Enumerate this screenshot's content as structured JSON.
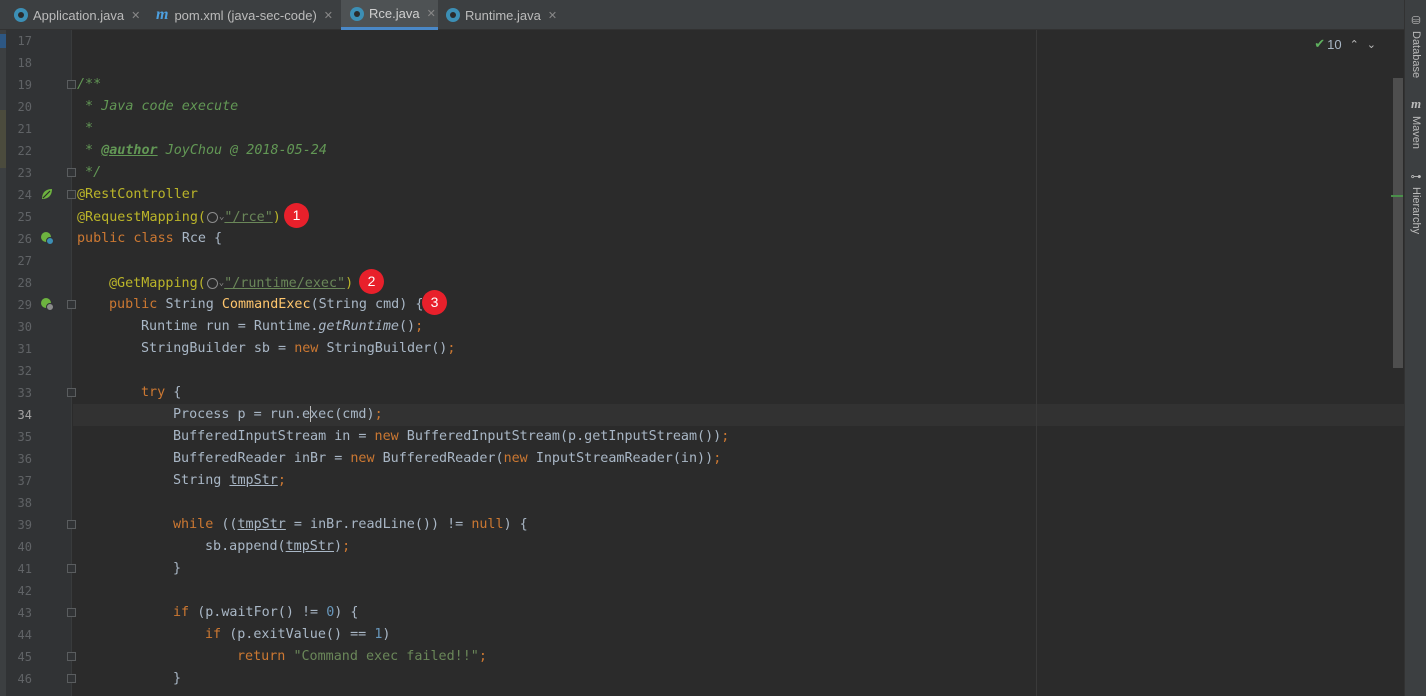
{
  "tabs": [
    {
      "label": "Application.java",
      "icon": "java-class-icon",
      "active": false
    },
    {
      "label": "pom.xml (java-sec-code)",
      "icon": "maven-icon",
      "active": false
    },
    {
      "label": "Rce.java",
      "icon": "java-class-icon",
      "active": true
    },
    {
      "label": "Runtime.java",
      "icon": "java-class-icon",
      "active": false
    }
  ],
  "tab_close_glyph": "✕",
  "line_numbers": [
    "17",
    "18",
    "19",
    "20",
    "21",
    "22",
    "23",
    "24",
    "25",
    "26",
    "27",
    "28",
    "29",
    "30",
    "31",
    "32",
    "33",
    "34",
    "35",
    "36",
    "37",
    "38",
    "39",
    "40",
    "41",
    "42",
    "43",
    "44",
    "45",
    "46"
  ],
  "current_line": "34",
  "code": {
    "l19": "/**",
    "l20": " * Java code execute",
    "l21": " *",
    "l22_pre": " * ",
    "l22_tag": "@author",
    "l22_post": " JoyChou @ 2018-05-24",
    "l23": " */",
    "l24": "@RestController",
    "l25_ann": "@RequestMapping(",
    "l25_str": "\"/rce\"",
    "l25_end": ")",
    "l26_kw": "public class ",
    "l26_rest": "Rce {",
    "l28_ann": "@GetMapping(",
    "l28_str": "\"/runtime/exec\"",
    "l28_end": ")",
    "l29_kw": "public ",
    "l29_type": "String ",
    "l29_fn": "CommandExec",
    "l29_rest": "(String cmd) {",
    "l30_a": "Runtime run = Runtime.",
    "l30_b": "getRuntime",
    "l30_c": "()",
    "l30_d": ";",
    "l31_a": "StringBuilder sb = ",
    "l31_b": "new ",
    "l31_c": "StringBuilder()",
    "l31_d": ";",
    "l33_a": "try ",
    "l33_b": "{",
    "l34_a": "Process p = run.e",
    "l34_b": "xec(cmd)",
    "l34_c": ";",
    "l35_a": "BufferedInputStream in = ",
    "l35_b": "new ",
    "l35_c": "BufferedInputStream(p.getInputStream())",
    "l35_d": ";",
    "l36_a": "BufferedReader inBr = ",
    "l36_b": "new ",
    "l36_c": "BufferedReader(",
    "l36_d": "new ",
    "l36_e": "InputStreamReader(in))",
    "l36_f": ";",
    "l37_a": "String ",
    "l37_b": "tmpStr",
    "l37_c": ";",
    "l39_a": "while ",
    "l39_b": "((",
    "l39_c": "tmpStr",
    "l39_d": " = inBr.readLine()) != ",
    "l39_e": "null",
    "l39_f": ") {",
    "l40_a": "sb.append(",
    "l40_b": "tmpStr",
    "l40_c": ")",
    "l40_d": ";",
    "l41": "}",
    "l43_a": "if ",
    "l43_b": "(p.waitFor() != ",
    "l43_c": "0",
    "l43_d": ") {",
    "l44_a": "if ",
    "l44_b": "(p.exitValue() == ",
    "l44_c": "1",
    "l44_d": ")",
    "l45_a": "return ",
    "l45_b": "\"Command exec failed!!\"",
    "l45_c": ";",
    "l46": "}"
  },
  "badges": [
    "1",
    "2",
    "3"
  ],
  "inspection": {
    "count": "10",
    "check_glyph": "✔",
    "up": "⌃",
    "down": "⌄"
  },
  "right_tools": [
    {
      "label": "Database",
      "icon": "database-icon",
      "glyph": "⛁"
    },
    {
      "label": "Maven",
      "icon": "maven-icon",
      "glyph": "m"
    },
    {
      "label": "Hierarchy",
      "icon": "hierarchy-icon",
      "glyph": "⊶"
    }
  ],
  "colors": {
    "keyword": "#cc7832",
    "annotation": "#bbb529",
    "string": "#6a8759",
    "comment": "#629755",
    "method": "#ffc66d",
    "badge": "#e8202b",
    "active_tab_underline": "#4a88c7"
  }
}
